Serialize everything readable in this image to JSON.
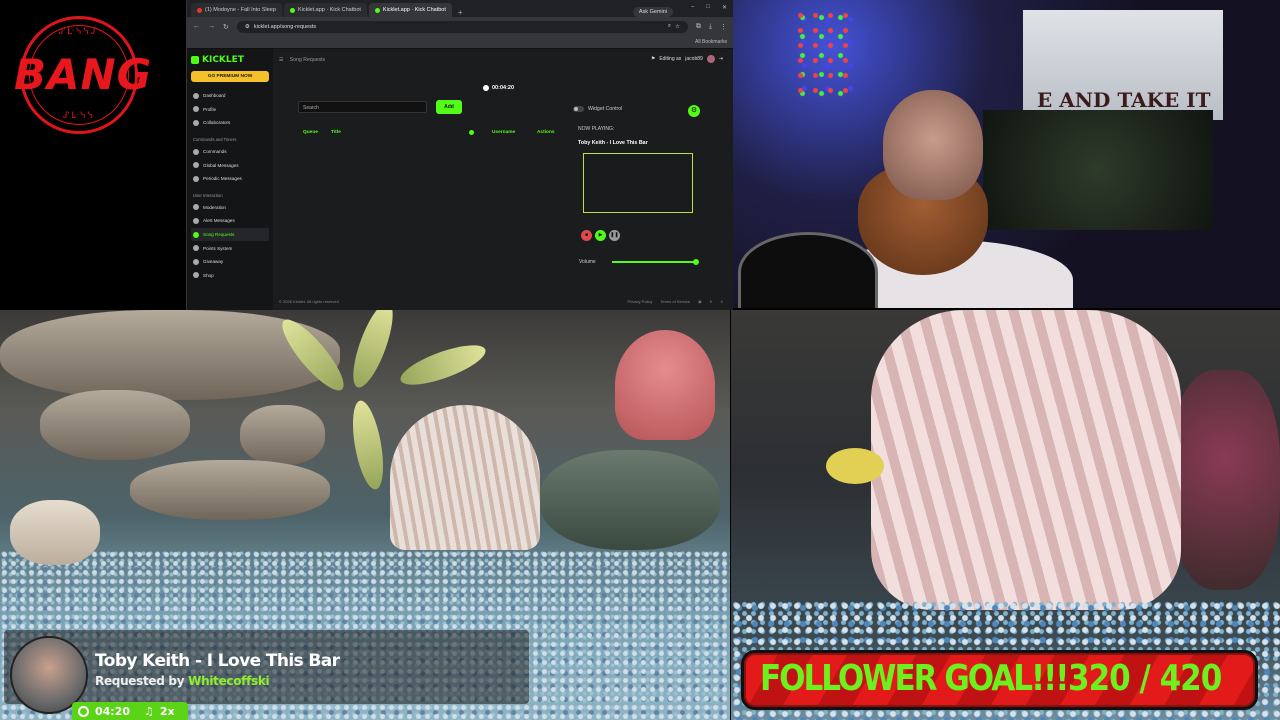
{
  "logo": {
    "arc_top": "ᔑᒷᓭᓭᔑ",
    "text": "BANG",
    "arc_bottom": "ᔑᒷᓭᓭ"
  },
  "browser": {
    "tabs": [
      {
        "label": "(1) Modoyne - Fall Into Sleep"
      },
      {
        "label": "Kicklet.app · Kick Chatbot"
      },
      {
        "label": "Kicklet.app · Kick Chatbot"
      }
    ],
    "gemini": "Ask Gemini",
    "url": "kicklet.app/song-requests",
    "bookmarks": "All Bookmarks"
  },
  "app": {
    "brand": "KICKLET",
    "premium": "GO PREMIUM NOW",
    "nav": [
      {
        "label": "Dashboard"
      },
      {
        "label": "Profile"
      },
      {
        "label": "Collaborators"
      }
    ],
    "section_commands": "Commands and Timers",
    "nav_commands": [
      {
        "label": "Commands"
      },
      {
        "label": "Global Messages"
      },
      {
        "label": "Periodic Messages"
      }
    ],
    "section_user": "User Interaction",
    "nav_user": [
      {
        "label": "Moderation"
      },
      {
        "label": "Alert Messages"
      },
      {
        "label": "Song Requests"
      },
      {
        "label": "Points System"
      },
      {
        "label": "Giveaway"
      },
      {
        "label": "Shop"
      }
    ],
    "page_title": "Song Requests",
    "editing_label": "Editing as",
    "editing_user": "jacob89",
    "timer": "00:04:20",
    "search_placeholder": "Search",
    "add_label": "Add",
    "columns": {
      "queue": "Queue",
      "title": "Title",
      "username": "Username",
      "actions": "Actions"
    },
    "widget_control": "Widget Control",
    "now_playing_label": "NOW PLAYING:",
    "now_playing_title": "Toby Keith - I Love This Bar",
    "volume_label": "Volume",
    "volume_level": 0.95,
    "footer_left": "© 2026 Kicklet. All rights reserved",
    "footer_links": [
      "Privacy Policy",
      "Terms of Service"
    ]
  },
  "webcam": {
    "poster_text": "E AND TAKE IT"
  },
  "song_overlay": {
    "title": "Toby Keith - I Love This Bar",
    "requested_prefix": "Requested by",
    "requested_user": "Whitecoffski",
    "time": "04:20",
    "count": "2x"
  },
  "follower_goal": {
    "label": "FOLLOWER GOAL!!!",
    "count": "320 / 420",
    "current": 320,
    "target": 420
  },
  "colors": {
    "kick_green": "#53fc18",
    "goal_red": "#e31a1a",
    "logo_red": "#e0141b",
    "premium_yellow": "#f5c12b"
  }
}
